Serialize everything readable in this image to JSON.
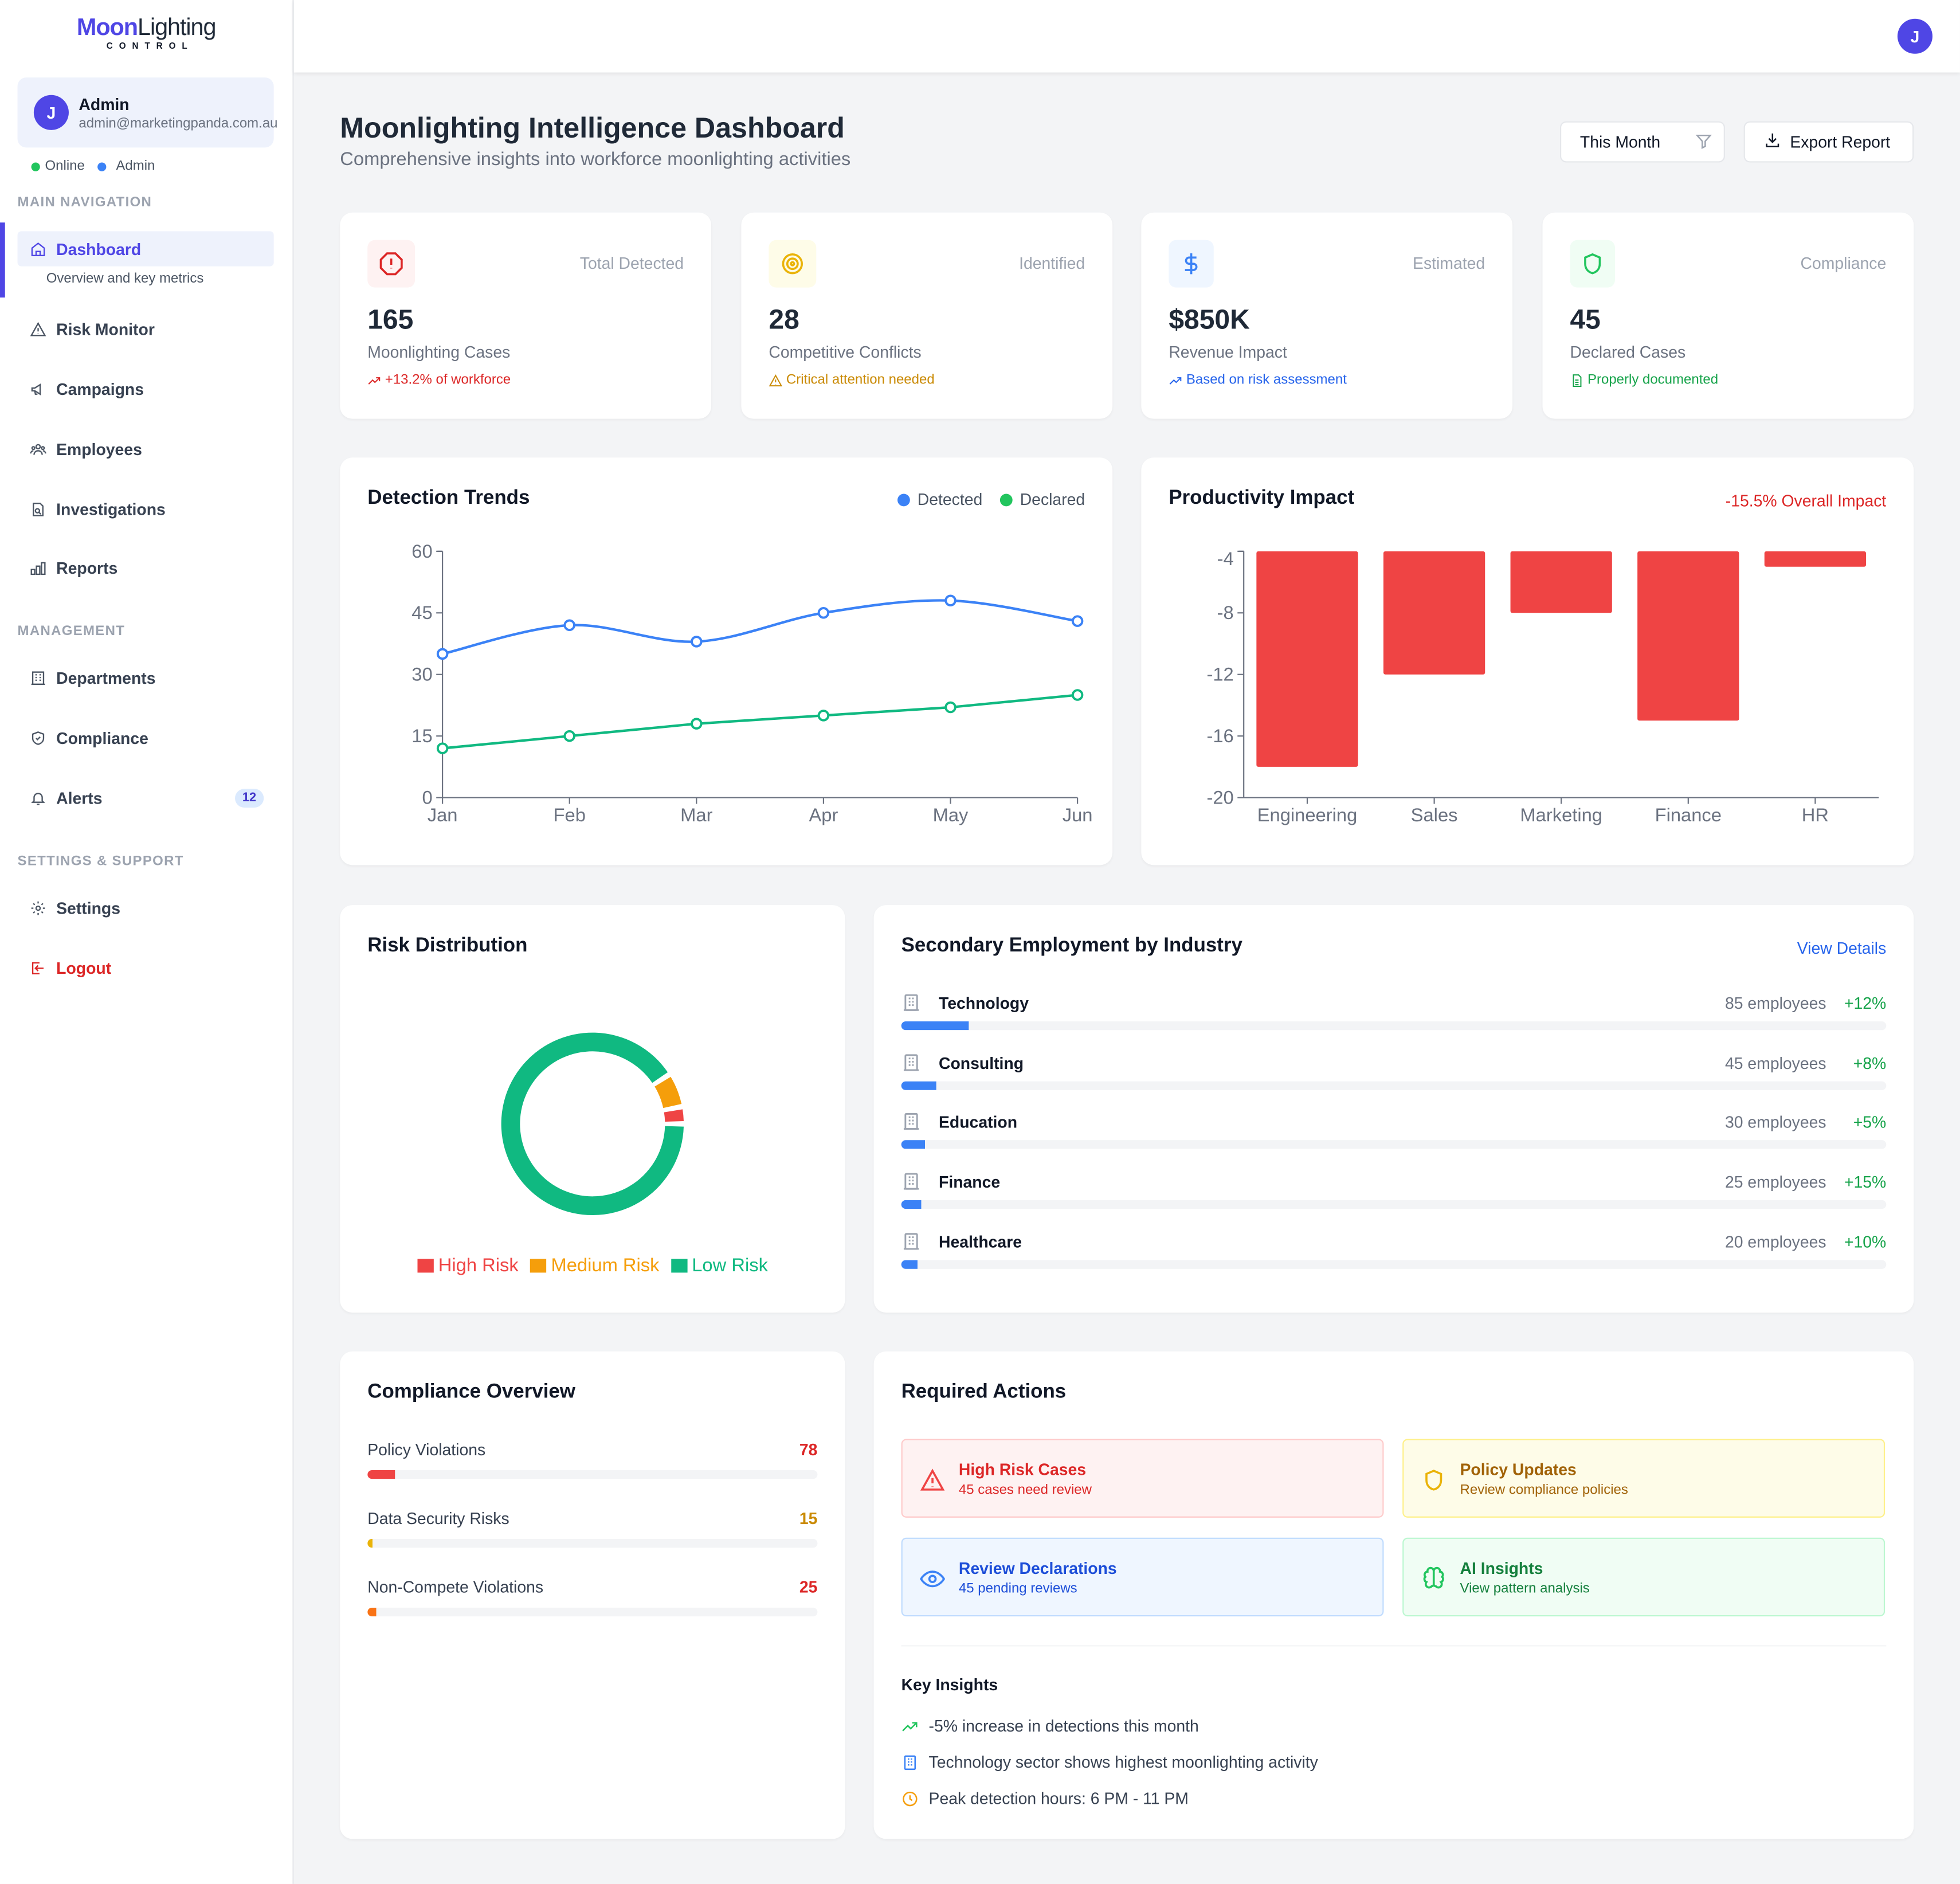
{
  "brand": {
    "name_part1": "Moon",
    "name_part2": "Lighting",
    "tagline": "CONTROL",
    "accent": "#4f46e5"
  },
  "user": {
    "initial": "J",
    "name": "Admin",
    "email": "admin@marketingpanda.com.au",
    "status": "Online",
    "role": "Admin"
  },
  "sidebar": {
    "sections": {
      "main": "MAIN NAVIGATION",
      "management": "MANAGEMENT",
      "settings": "SETTINGS & SUPPORT"
    },
    "items": [
      {
        "label": "Dashboard",
        "sub": "Overview and key metrics",
        "icon": "home-icon",
        "active": true
      },
      {
        "label": "Risk Monitor",
        "icon": "warning-triangle-icon"
      },
      {
        "label": "Campaigns",
        "icon": "megaphone-icon"
      },
      {
        "label": "Employees",
        "icon": "users-icon"
      },
      {
        "label": "Investigations",
        "icon": "file-search-icon"
      },
      {
        "label": "Reports",
        "icon": "bar-chart-icon"
      },
      {
        "label": "Departments",
        "icon": "building-icon"
      },
      {
        "label": "Compliance",
        "icon": "shield-check-icon"
      },
      {
        "label": "Alerts",
        "icon": "bell-icon",
        "badge": "12"
      },
      {
        "label": "Settings",
        "icon": "gear-icon"
      },
      {
        "label": "Logout",
        "icon": "logout-icon"
      }
    ]
  },
  "header": {
    "title": "Moonlighting Intelligence Dashboard",
    "subtitle": "Comprehensive insights into workforce moonlighting activities",
    "period_select": "This Month",
    "export_label": "Export Report"
  },
  "stats": [
    {
      "label": "Total Detected",
      "value": "165",
      "caption": "Moonlighting Cases",
      "note": "+13.2% of workforce",
      "color": "#dc2626",
      "bg": "#fef2f2",
      "icon": "alert-octagon-icon"
    },
    {
      "label": "Identified",
      "value": "28",
      "caption": "Competitive Conflicts",
      "note": "Critical attention needed",
      "color": "#ca8a04",
      "bg": "#fefce8",
      "icon": "target-icon"
    },
    {
      "label": "Estimated",
      "value": "$850K",
      "caption": "Revenue Impact",
      "note": "Based on risk assessment",
      "color": "#2563eb",
      "bg": "#eff6ff",
      "icon": "dollar-icon"
    },
    {
      "label": "Compliance",
      "value": "45",
      "caption": "Declared Cases",
      "note": "Properly documented",
      "color": "#16a34a",
      "bg": "#f0fdf4",
      "icon": "shield-icon"
    }
  ],
  "detection": {
    "title": "Detection Trends",
    "legend": [
      "Detected",
      "Declared"
    ]
  },
  "productivity": {
    "title": "Productivity Impact",
    "impact": "-15.5% Overall Impact"
  },
  "risk": {
    "title": "Risk Distribution",
    "legend": [
      "High Risk",
      "Medium Risk",
      "Low Risk"
    ]
  },
  "chart_data": [
    {
      "type": "line",
      "title": "Detection Trends",
      "categories": [
        "Jan",
        "Feb",
        "Mar",
        "Apr",
        "May",
        "Jun"
      ],
      "series": [
        {
          "name": "Detected",
          "color": "#3b82f6",
          "values": [
            35,
            42,
            38,
            45,
            48,
            43
          ]
        },
        {
          "name": "Declared",
          "color": "#10b981",
          "values": [
            12,
            15,
            18,
            20,
            22,
            25
          ]
        }
      ],
      "yticks": [
        "0",
        "15",
        "30",
        "45",
        "60"
      ],
      "ylim": [
        0,
        60
      ],
      "legend": "top-right",
      "grid": false
    },
    {
      "type": "bar",
      "title": "Productivity Impact",
      "categories": [
        "Engineering",
        "Sales",
        "Marketing",
        "Finance",
        "HR"
      ],
      "values": [
        -18,
        -12,
        -8,
        -15,
        -5
      ],
      "color": "#ef4444",
      "yticks": [
        "-4",
        "-8",
        "-12",
        "-16",
        "-20"
      ],
      "ylim": [
        -20,
        -4
      ],
      "grid": false
    },
    {
      "type": "pie",
      "title": "Risk Distribution",
      "labels": [
        "High Risk",
        "Medium Risk",
        "Low Risk"
      ],
      "values": [
        5,
        10,
        150
      ],
      "colors": [
        "#ef4444",
        "#f59e0b",
        "#10b981"
      ],
      "legend": "bottom"
    }
  ],
  "industry": {
    "title": "Secondary Employment by Industry",
    "link": "View Details",
    "rows": [
      {
        "name": "Technology",
        "count": "85 employees",
        "growth": "+12%",
        "fill_pct": 6.8
      },
      {
        "name": "Consulting",
        "count": "45 employees",
        "growth": "+8%",
        "fill_pct": 3.6
      },
      {
        "name": "Education",
        "count": "30 employees",
        "growth": "+5%",
        "fill_pct": 2.4
      },
      {
        "name": "Finance",
        "count": "25 employees",
        "growth": "+15%",
        "fill_pct": 2.0
      },
      {
        "name": "Healthcare",
        "count": "20 employees",
        "growth": "+10%",
        "fill_pct": 1.6
      }
    ]
  },
  "compliance": {
    "title": "Compliance Overview",
    "rows": [
      {
        "label": "Policy Violations",
        "value": "78",
        "color": "#dc2626",
        "bar": "#ef4444",
        "fill_pct": 6.2
      },
      {
        "label": "Data Security Risks",
        "value": "15",
        "color": "#ca8a04",
        "bar": "#eab308",
        "fill_pct": 1.1
      },
      {
        "label": "Non-Compete Violations",
        "value": "25",
        "color": "#dc2626",
        "bar": "#f97316",
        "fill_pct": 2.0
      }
    ]
  },
  "actions": {
    "title": "Required Actions",
    "items": [
      {
        "title": "High Risk Cases",
        "sub": "45 cases need review",
        "icon": "warning-triangle-icon",
        "color": "#dc2626",
        "bg": "#fef2f2",
        "border": "#fecaca"
      },
      {
        "title": "Policy Updates",
        "sub": "Review compliance policies",
        "icon": "shield-icon",
        "color": "#a16207",
        "bg": "#fefce8",
        "border": "#fef08a"
      },
      {
        "title": "Review Declarations",
        "sub": "45 pending reviews",
        "icon": "eye-icon",
        "color": "#1d4ed8",
        "bg": "#eff6ff",
        "border": "#bfdbfe"
      },
      {
        "title": "AI Insights",
        "sub": "View pattern analysis",
        "icon": "brain-icon",
        "color": "#15803d",
        "bg": "#f0fdf4",
        "border": "#bbf7d0"
      }
    ],
    "insights_title": "Key Insights",
    "insights": [
      {
        "text": "-5% increase in detections this month",
        "icon": "trending-up-icon"
      },
      {
        "text": "Technology sector shows highest moonlighting activity",
        "icon": "building-icon"
      },
      {
        "text": "Peak detection hours: 6 PM - 11 PM",
        "icon": "clock-icon"
      }
    ]
  }
}
